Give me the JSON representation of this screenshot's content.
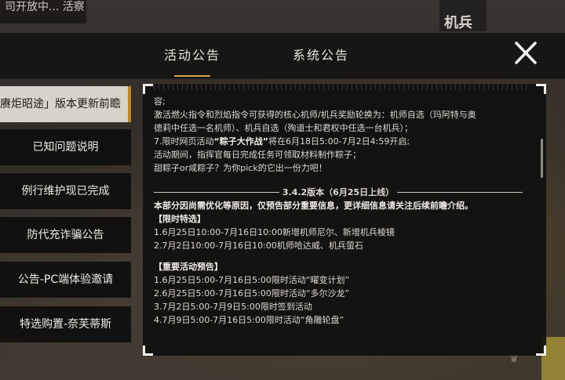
{
  "background": {
    "top_left_text": "司开放中... 活察",
    "top_right_text": "机兵"
  },
  "tabs": [
    {
      "label": "活动公告",
      "active": true
    },
    {
      "label": "系统公告",
      "active": false
    }
  ],
  "close_icon": "close-x-icon",
  "sidebar": {
    "items": [
      {
        "label": "赓炬昭途」版本更新前瞻",
        "active": true
      },
      {
        "label": "已知问题说明",
        "active": false
      },
      {
        "label": "例行维护现已完成",
        "active": false
      },
      {
        "label": "防代充诈骗公告",
        "active": false
      },
      {
        "label": "公告-PC端体验邀请",
        "active": false
      },
      {
        "label": "特选购置-奈芙蒂斯",
        "active": false
      }
    ]
  },
  "content": {
    "line1": "容;",
    "line2": "激活燃火指令和烈焰指令可获得的核心机师/机兵奖励轮换为：机师自选（玛阿特与奥",
    "line3": "德莉中任选一名机师）、机兵自选（殉道士和君权中任选一台机兵）；",
    "line4_prefix": "7.限时网页活动",
    "line4_bold": "“粽子大作战”",
    "line4_suffix": "将在6月18日5:00-7月2日4:59开启;",
    "line5": "活动期间，指挥官每日完成任务可领取材料制作粽子；",
    "line6": "甜粽子or咸粽子？为你pick的它出一份力吧！",
    "version_divider": "3.4.2版本（6月25日上线）",
    "notice": "本部分因尚需优化等原因，仅预告部分重要信息，更详细信息请关注后续前瞻介绍。",
    "limited_title": "【限时特选】",
    "limited_1": "1.6月25日10:00-7月16日10:00新增机师尼尔、新增机兵棱镜",
    "limited_2": "2.7月2日10:00-7月16日10:00机师哈达威、机兵萤石",
    "events_title": "【重要活动预告】",
    "event_1": "1.6月25日5:00-7月16日5:00限时活动“曜变计划”",
    "event_2": "2.6月25日5:00-7月16日5:00限时活动“多尔沙龙”",
    "event_3": "3.7月2日5:00-7月9日5:00限时签到活动",
    "event_4": "4.7月9日5:00-7月16日5:00限时活动“角雕轮盘”"
  },
  "colors": {
    "accent": "#d9a34a",
    "panel_bg": "#101010",
    "active_tab_bg": "#d8d3c9"
  }
}
